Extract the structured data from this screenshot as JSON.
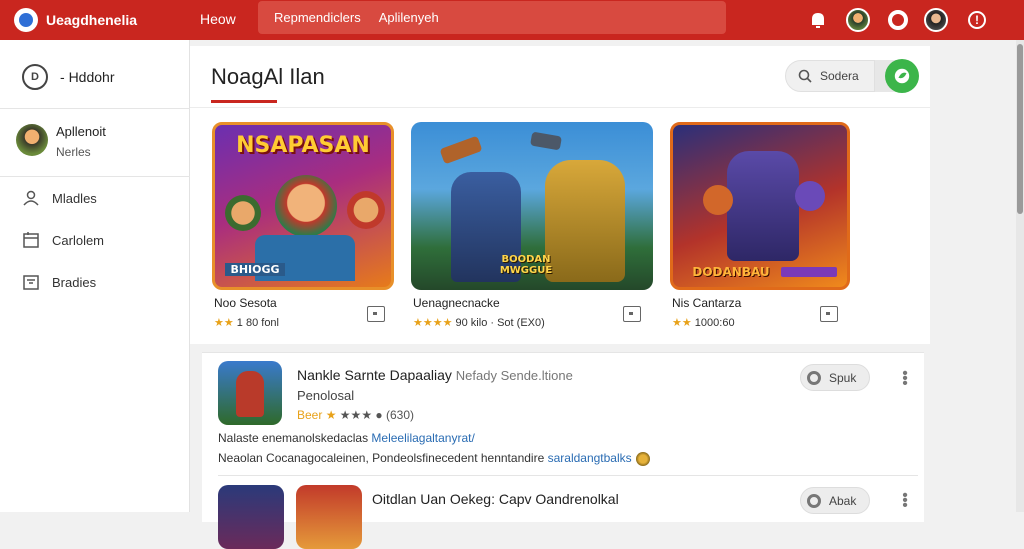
{
  "topbar": {
    "brand": "Ueagdhenelia",
    "home": "Heow",
    "search_tabs": [
      "Repmendiclers",
      "Aplilenyeh"
    ]
  },
  "sidebar": {
    "header": "Hddohr",
    "header_icon": "D",
    "profile": {
      "name": "Apllenoit",
      "sub": "Nerles"
    },
    "items": [
      {
        "label": "Mladles",
        "icon": "person-icon"
      },
      {
        "label": "Carlolem",
        "icon": "calendar-icon"
      },
      {
        "label": "Bradies",
        "icon": "tray-icon"
      }
    ]
  },
  "featured": {
    "title": "NoagAl Ilan",
    "search_label": "Sodera",
    "games": [
      {
        "art_text": "NSAPASAN",
        "art_text2": "BHIOGG",
        "name": "Noo Sesota",
        "rating": "1 80 fonl",
        "stars": "★★"
      },
      {
        "art_text": "",
        "art_text2": "BOODAN MWGGUE",
        "name": "Uenagnecnacke",
        "rating": "90 kilo · Sot (EX0)",
        "stars": "★★★★"
      },
      {
        "art_text": "",
        "art_text2": "DODANBAU",
        "name": "Nis Cantarza",
        "rating": "1000:60",
        "stars": "★★"
      }
    ]
  },
  "list": [
    {
      "title": "Nankle Sarnte Dapaaliay",
      "title_muted": "Nefady Sende.ltione",
      "sub": "Penolosal",
      "rating_label": "Beer",
      "rating_count": "(630)",
      "desc1_plain": "Nalaste enemanolskedaclas ",
      "desc1_link": "Meleelilagaltanyrat/",
      "desc2_plain": "Neaolan Cocanagocaleinen, Pondeolsfinecedent henntandire ",
      "desc2_link": "saraldangtbalks",
      "button": "Spuk"
    },
    {
      "title": "Oitdlan Uan Oekeg: Capv Oandrenolkal",
      "button": "Abak"
    }
  ],
  "colors": {
    "brand_red": "#c9261f",
    "accent_green": "#3cb54a",
    "star": "#e8a21a",
    "link_blue": "#2a6cb3"
  }
}
